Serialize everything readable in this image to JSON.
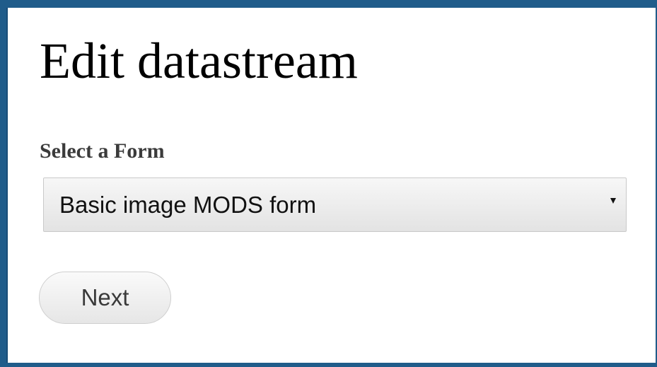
{
  "page": {
    "title": "Edit datastream"
  },
  "form": {
    "label": "Select a Form",
    "select": {
      "selected_value": "Basic image MODS form"
    },
    "next_button_label": "Next"
  },
  "colors": {
    "frame_border": "#205c8a",
    "background": "#ffffff",
    "label_text": "#3b3b3b"
  },
  "icons": {
    "select_arrow": "caret-down-icon"
  }
}
